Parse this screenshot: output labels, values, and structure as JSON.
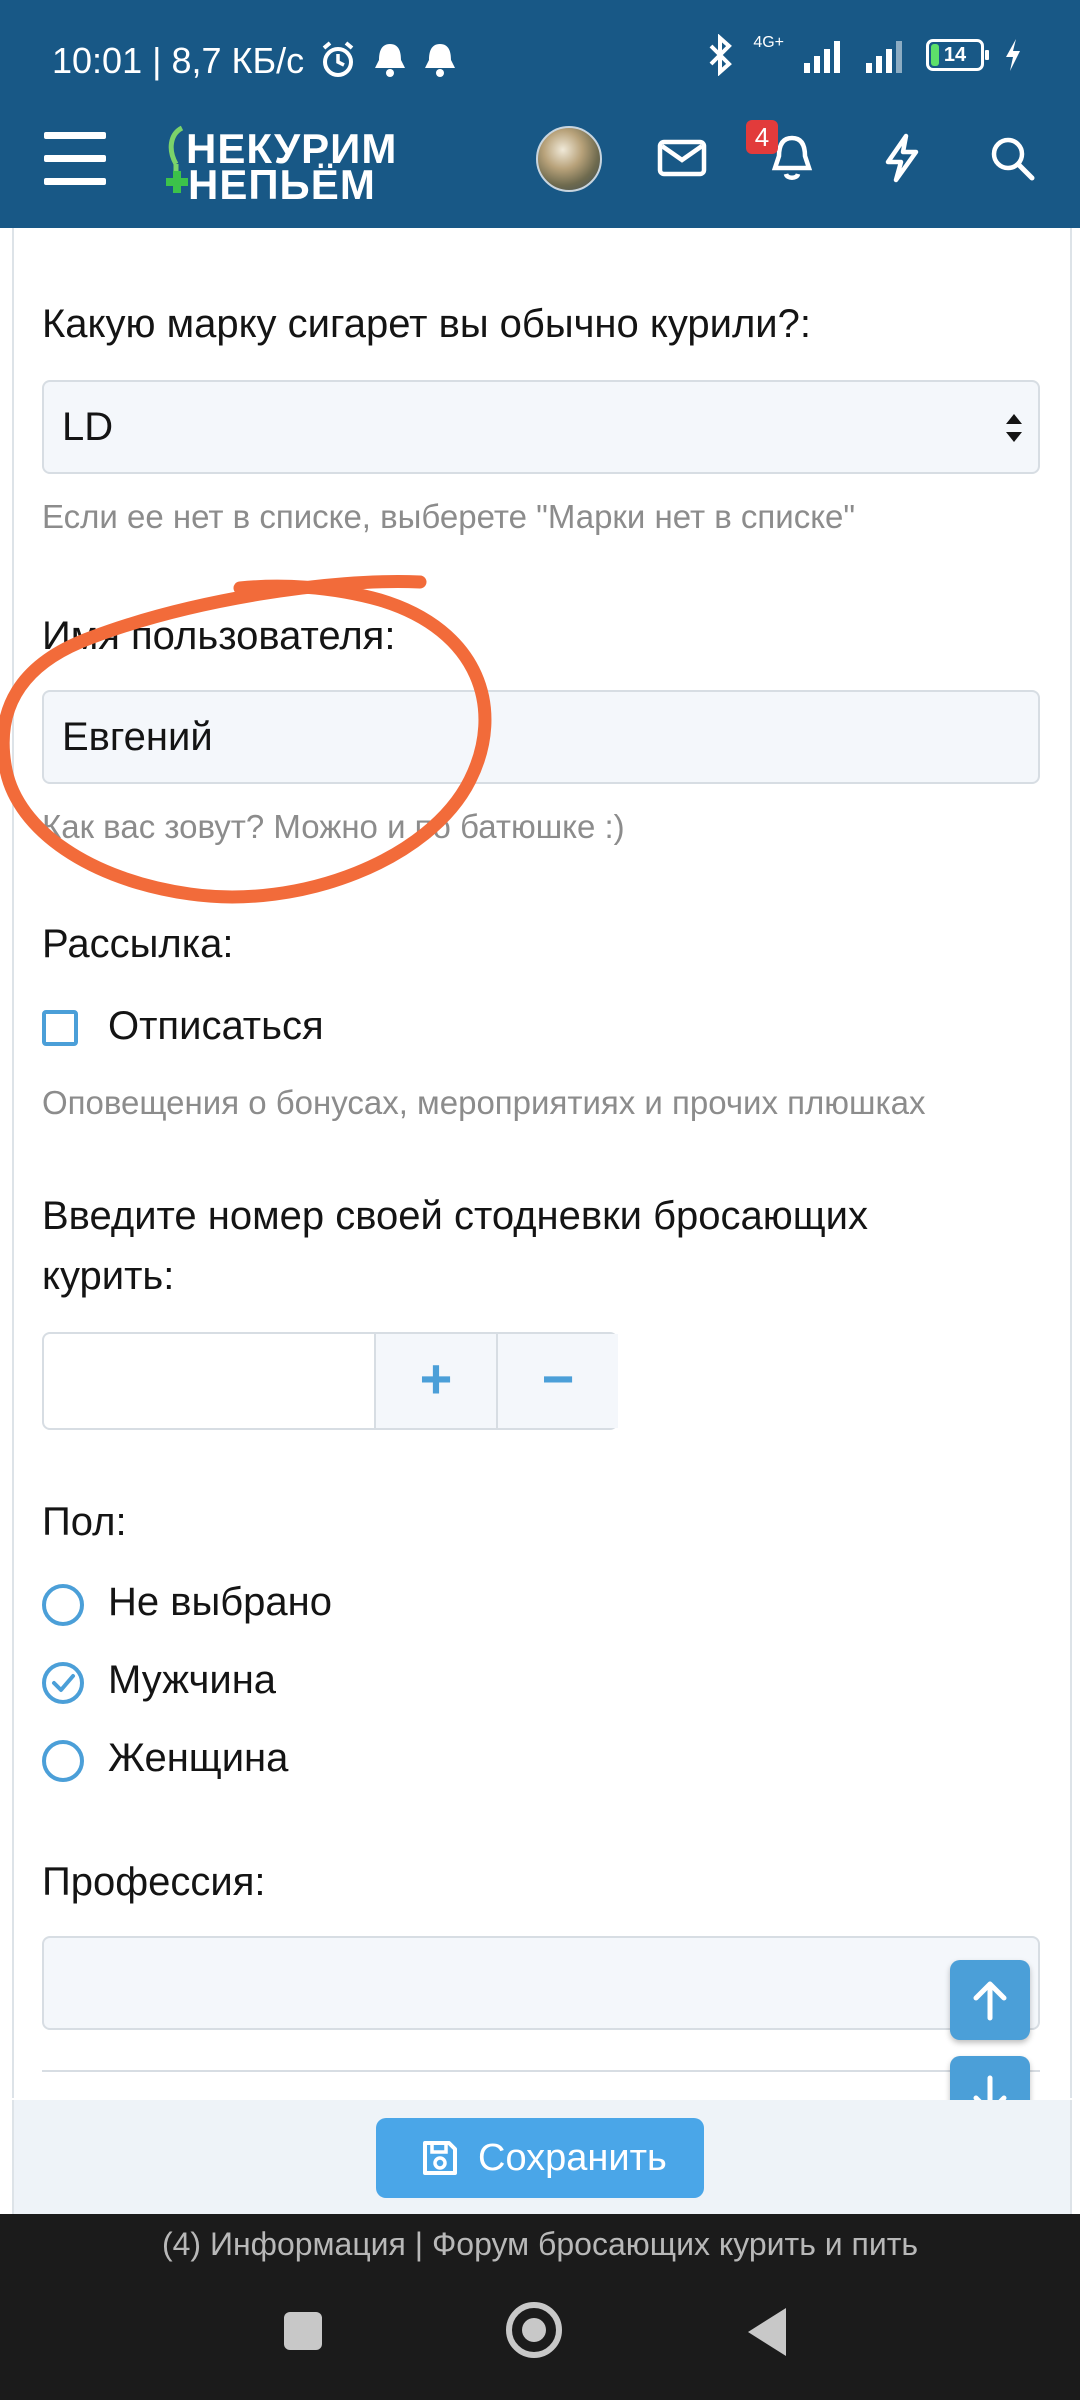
{
  "status_bar": {
    "time": "10:01 | 8,7 КБ/с",
    "network": "4G+",
    "battery": "14"
  },
  "header": {
    "logo_line1": "НЕКУРИМ",
    "logo_line2": "НЕПЬЁМ",
    "notification_count": "4",
    "icons": [
      "menu-icon",
      "avatar",
      "mail-icon",
      "bell-icon",
      "lightning-icon",
      "search-icon"
    ]
  },
  "form": {
    "brand": {
      "label": "Какую марку сигарет вы обычно курили?:",
      "value": "LD",
      "hint": "Если ее нет в списке, выберете \"Марки нет в списке\""
    },
    "username": {
      "label": "Имя пользователя:",
      "value": "Евгений",
      "hint": "Как вас зовут? Можно и по батюшке :)"
    },
    "mailing": {
      "label": "Рассылка:",
      "checkbox_label": "Отписаться",
      "checked": false,
      "hint": "Оповещения о бонусах, мероприятиях и прочих плюшках"
    },
    "hundred_day": {
      "label_line1": "Введите номер своей стодневки бросающих",
      "label_line2": "курить:",
      "value": "",
      "plus": "+",
      "minus": "−"
    },
    "gender": {
      "label": "Пол:",
      "options": [
        "Не выбрано",
        "Мужчина",
        "Женщина"
      ],
      "selected": "Мужчина"
    },
    "profession": {
      "label": "Профессия:",
      "value": ""
    }
  },
  "save_button": {
    "label": "Сохранить"
  },
  "browser": {
    "page_title": "(4) Информация | Форум бросающих курить и пить"
  },
  "colors": {
    "header_bg": "#185886",
    "accent": "#4b9fd8",
    "save_button": "#4aa6e8",
    "annotation": "#f26b3a",
    "badge": "#e23b3b"
  }
}
